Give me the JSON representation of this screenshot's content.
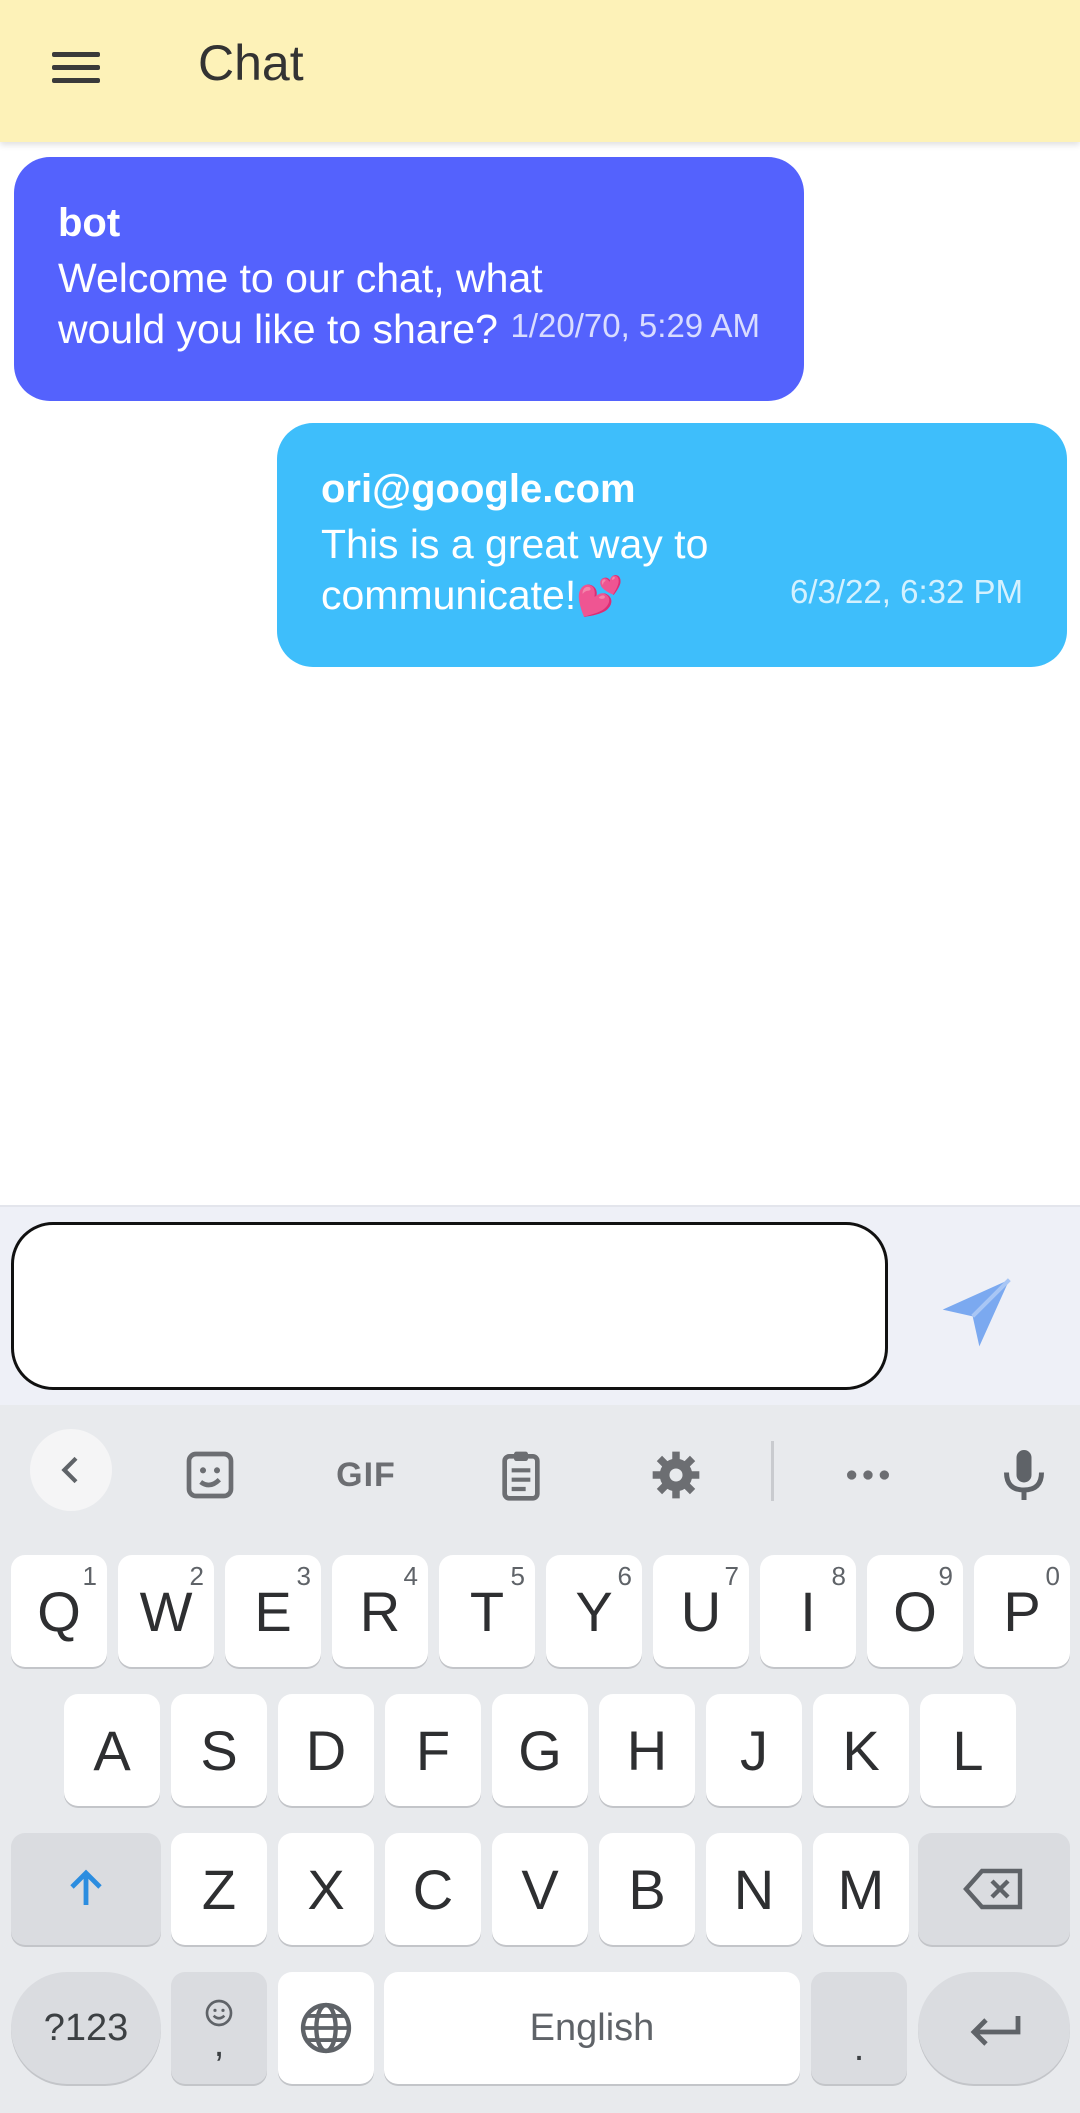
{
  "app_bar": {
    "title": "Chat",
    "background": "#fdf2b8"
  },
  "messages": [
    {
      "sender": "bot",
      "text": "Welcome to our chat, what would you like to share?",
      "time": "1/20/70, 5:29 AM",
      "color": "#5462fd"
    },
    {
      "sender": "ori@google.com",
      "text": "This is a great way to communicate!",
      "emoji": "💕",
      "time": "6/3/22, 6:32 PM",
      "color": "#3ebefb"
    }
  ],
  "composer": {
    "value": "",
    "placeholder": "",
    "send_icon": "send-icon"
  },
  "keyboard": {
    "toolbar": [
      "chevron-left-icon",
      "sticker-icon",
      "GIF",
      "clipboard-icon",
      "settings-icon",
      "more-icon",
      "mic-icon"
    ],
    "row1": [
      {
        "k": "Q",
        "h": "1"
      },
      {
        "k": "W",
        "h": "2"
      },
      {
        "k": "E",
        "h": "3"
      },
      {
        "k": "R",
        "h": "4"
      },
      {
        "k": "T",
        "h": "5"
      },
      {
        "k": "Y",
        "h": "6"
      },
      {
        "k": "U",
        "h": "7"
      },
      {
        "k": "I",
        "h": "8"
      },
      {
        "k": "O",
        "h": "9"
      },
      {
        "k": "P",
        "h": "0"
      }
    ],
    "row2": [
      "A",
      "S",
      "D",
      "F",
      "G",
      "H",
      "J",
      "K",
      "L"
    ],
    "row3": [
      "Z",
      "X",
      "C",
      "V",
      "B",
      "N",
      "M"
    ],
    "bottom": {
      "symbols": "?123",
      "comma": ",",
      "space": "English",
      "period": "."
    }
  }
}
